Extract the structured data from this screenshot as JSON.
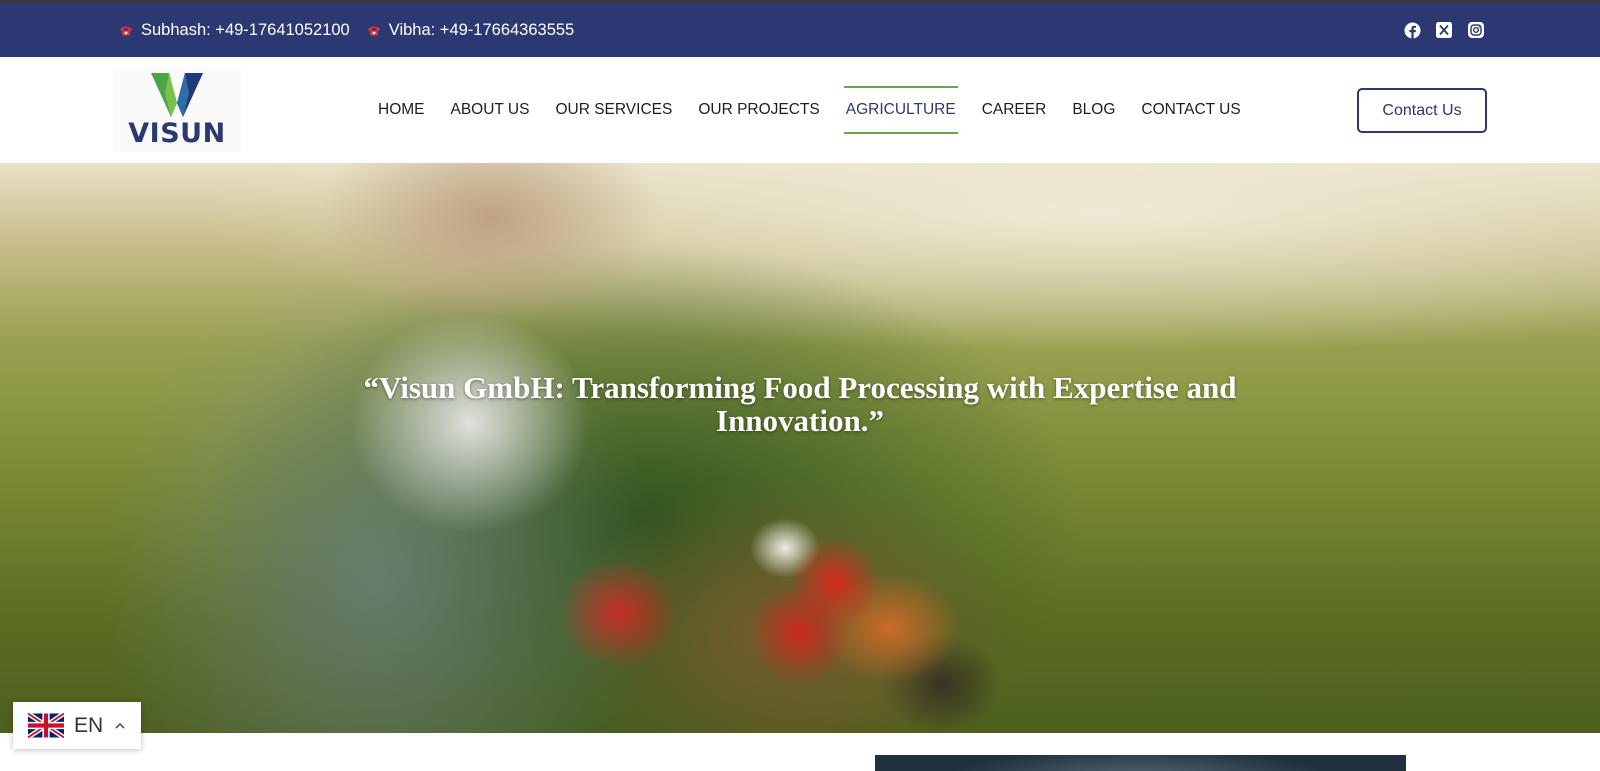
{
  "topbar": {
    "contacts": [
      {
        "icon": "phone-icon",
        "label": "Subhash: +49-17641052100"
      },
      {
        "icon": "phone-icon",
        "label": "Vibha: +49-17664363555"
      }
    ],
    "socials": [
      "facebook-icon",
      "x-icon",
      "instagram-icon"
    ]
  },
  "header": {
    "logo_text": "VISUN",
    "nav": [
      "HOME",
      "ABOUT US",
      "OUR SERVICES",
      "OUR PROJECTS",
      "AGRICULTURE",
      "CAREER",
      "BLOG",
      "CONTACT US"
    ],
    "active_nav": "AGRICULTURE",
    "cta_label": "Contact Us"
  },
  "hero": {
    "title_line1": "“Visun GmbH: Transforming Food Processing with Expertise and",
    "title_line2": "Innovation.”"
  },
  "language": {
    "code": "EN",
    "flag": "uk-flag-icon"
  },
  "colors": {
    "brand": "#2b3872",
    "accent": "#6aa84f",
    "topbar_bg": "#2b3872"
  }
}
